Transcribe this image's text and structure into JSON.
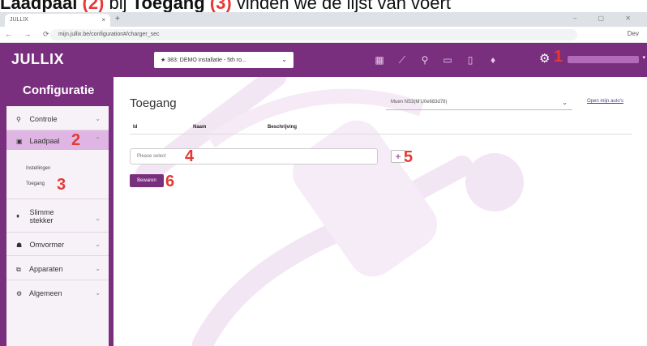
{
  "caption": {
    "part1": "Laadpaal",
    "num1": "(2)",
    "part2": "bij",
    "part3": "Toegang",
    "num2": "(3)",
    "part4": "vinden we de lijst van voert"
  },
  "browser": {
    "tab_title": "JULLIX",
    "tab_close": "×",
    "new_tab": "+",
    "window_controls": "–  ▢  ✕",
    "nav": "←  →  ⟳",
    "url": "mijn.jullix.be/configuration#/charger_sec",
    "profile": "Dev"
  },
  "header": {
    "logo": "JULLIX",
    "site_select": "★ 383: DEMO installatie - 5th ro...",
    "chevron": "⌄"
  },
  "annotations": [
    "1",
    "2",
    "3",
    "4",
    "5",
    "6"
  ],
  "sidebar": {
    "title": "Configuratie",
    "items": [
      {
        "label": "Controle",
        "icon": "search-icon"
      },
      {
        "label": "Laadpaal",
        "icon": "charger-icon"
      },
      {
        "label": "Slimme stekker",
        "icon": "plug-icon"
      },
      {
        "label": "Omvormer",
        "icon": "inverter-icon"
      },
      {
        "label": "Apparaten",
        "icon": "devices-icon"
      },
      {
        "label": "Algemeen",
        "icon": "gear-icon"
      }
    ],
    "sub_items": [
      "Instellingen",
      "Toegang"
    ]
  },
  "main": {
    "title": "Toegang",
    "filter_value": "Muen NS3(M'U0e683d78)",
    "link": "Open mijn auto's",
    "columns": [
      "Id",
      "Naam",
      "Beschrijving"
    ],
    "picker_placeholder": "Please select",
    "add_label": "+",
    "save_label": "Bewaren"
  },
  "colors": {
    "brand": "#7a2e7e",
    "active": "#dfb6e3",
    "annotation": "#e53935"
  }
}
